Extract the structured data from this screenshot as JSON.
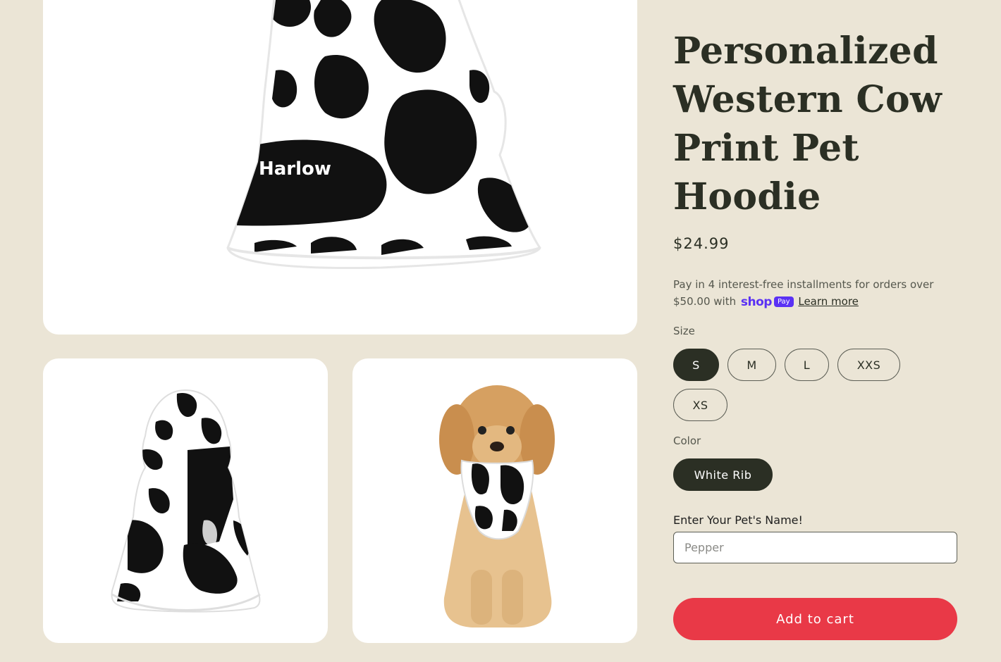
{
  "product": {
    "title": "Personalized Western Cow Print Pet Hoodie",
    "price": "$24.99",
    "images": {
      "main_print_name": "Harlow"
    }
  },
  "installments": {
    "text_before": "Pay in 4 interest-free installments for orders over $50.00 with",
    "shop_word": "shop",
    "pay_badge": "Pay",
    "learn_more": "Learn more"
  },
  "options": {
    "size_label": "Size",
    "sizes": [
      "S",
      "M",
      "L",
      "XXS",
      "XS"
    ],
    "selected_size": "S",
    "color_label": "Color",
    "colors": [
      "White Rib"
    ],
    "selected_color": "White Rib"
  },
  "personalization": {
    "label": "Enter Your Pet's Name!",
    "placeholder": "Pepper",
    "value": ""
  },
  "actions": {
    "add_to_cart": "Add to cart"
  },
  "colors": {
    "background": "#ebe5d6",
    "text_dark": "#2b2f24",
    "accent_button": "#e93947",
    "shop_pay": "#5a31f4"
  }
}
